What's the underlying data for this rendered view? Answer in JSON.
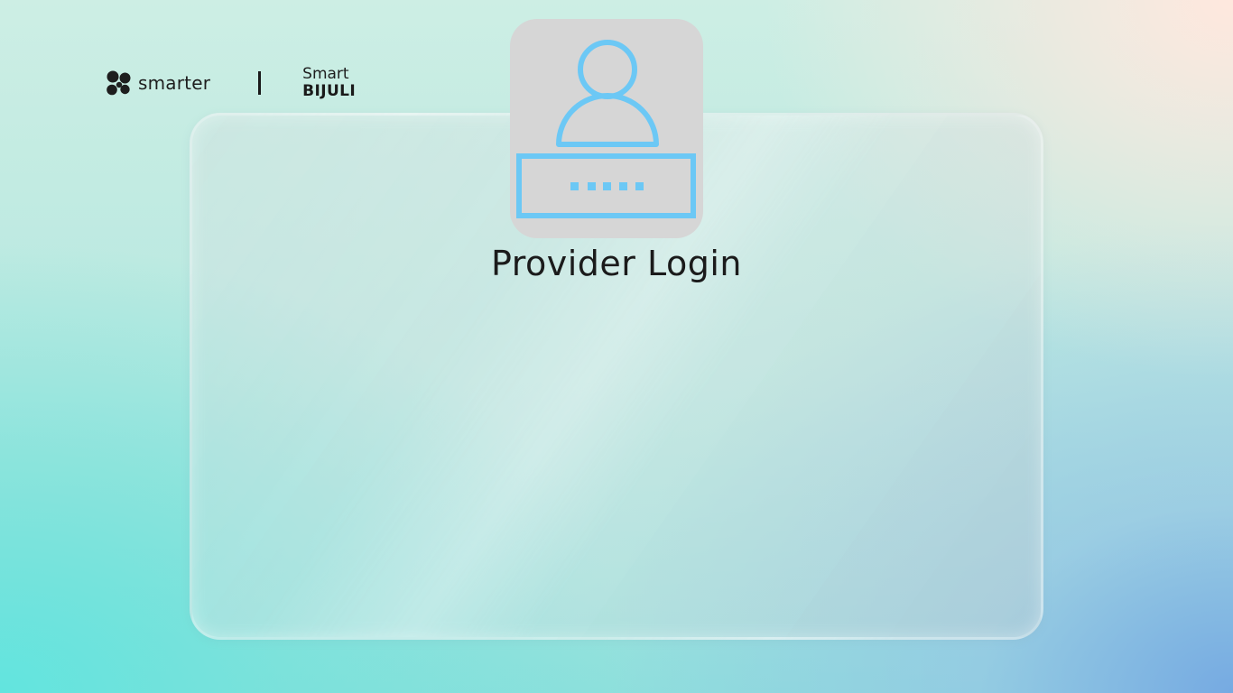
{
  "brand": {
    "smarter_label": "smarter",
    "smarter_icon": "smarter-logo-icon",
    "bijuli_line1": "Smart",
    "bijuli_line2": "BIJULI"
  },
  "login_icon": {
    "name": "user-password-icon",
    "color": "#6cc8f5"
  },
  "page": {
    "title": "Provider Login"
  },
  "colors": {
    "icon_accent": "#6cc8f5",
    "tile_background": "#d6d6d6",
    "text": "#1b1b1b"
  }
}
